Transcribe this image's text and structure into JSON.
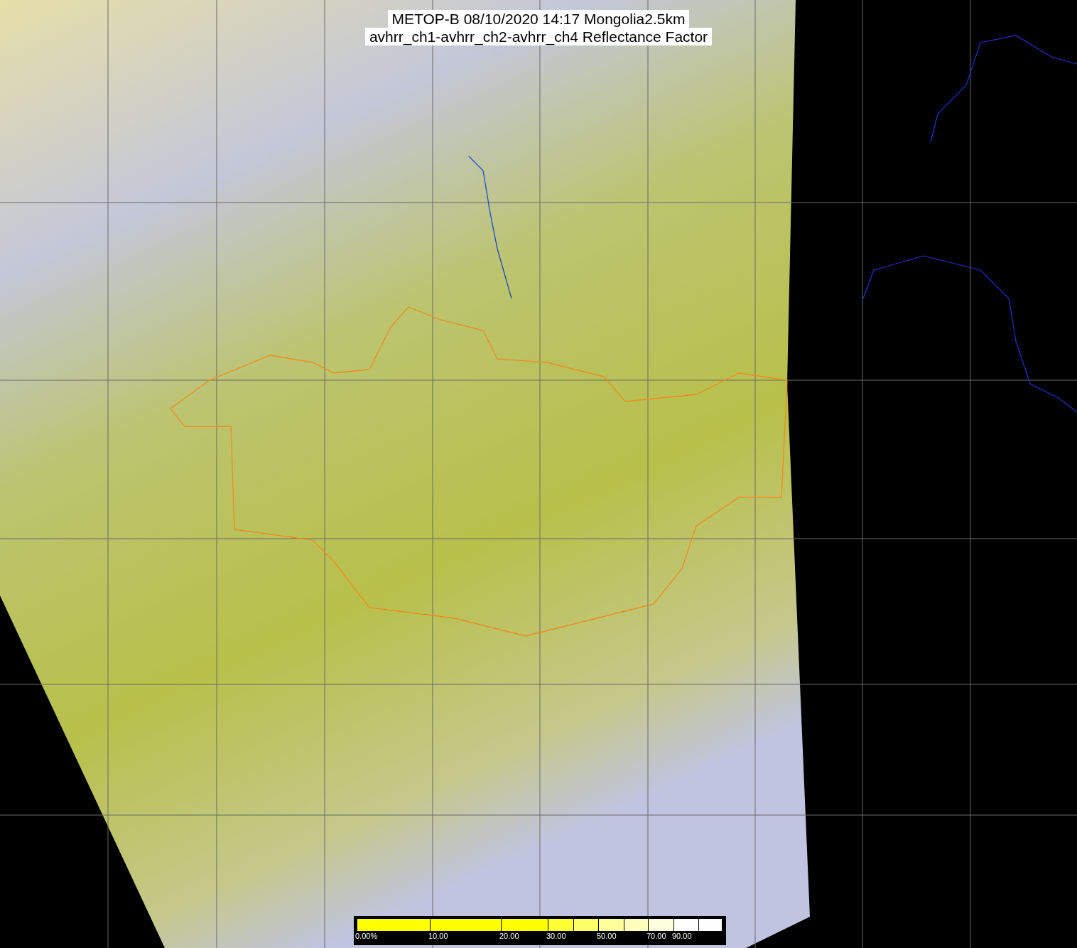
{
  "title": {
    "lines": [
      "METOP-B 08/10/2020 14:17 Mongolia2.5km",
      "avhrr_ch1-avhrr_ch2-avhrr_ch4 Reflectance Factor"
    ]
  },
  "legend": {
    "segments": [
      {
        "color": "#ffff00",
        "label": "0.00%"
      },
      {
        "color": "#ffff00",
        "label": "10.00"
      },
      {
        "color": "#ffff00",
        "label": "20.00"
      },
      {
        "color": "#ffff33",
        "label": "30.00"
      },
      {
        "color": "#ffff66"
      },
      {
        "color": "#ffff99",
        "label": "50.00"
      },
      {
        "color": "#ffffbb"
      },
      {
        "color": "#ffffdd",
        "label": "70.00"
      },
      {
        "color": "#ffffff",
        "label": "90.00"
      },
      {
        "color": "#ffffff"
      }
    ]
  }
}
